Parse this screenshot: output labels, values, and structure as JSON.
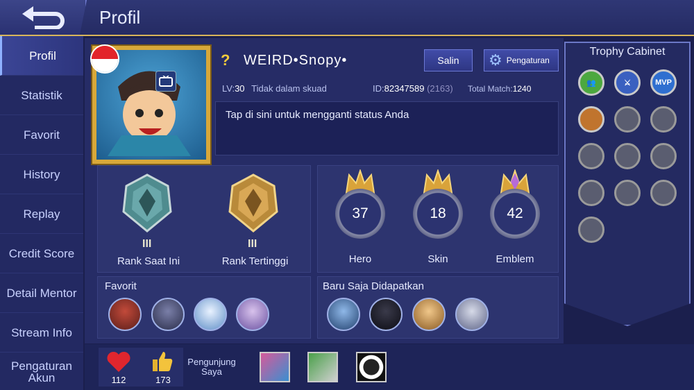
{
  "header": {
    "title": "Profil"
  },
  "sidebar": {
    "items": [
      {
        "label": "Profil"
      },
      {
        "label": "Statistik"
      },
      {
        "label": "Favorit"
      },
      {
        "label": "History"
      },
      {
        "label": "Replay"
      },
      {
        "label": "Credit Score"
      },
      {
        "label": "Detail Mentor"
      },
      {
        "label": "Stream Info"
      },
      {
        "label": "Pengaturan Akun"
      }
    ]
  },
  "profile": {
    "name_prefix": "?",
    "name": "WEIRD•Snopy•",
    "copy_button": "Salin",
    "settings_button": "Pengaturan",
    "level_label": "LV:",
    "level": "30",
    "squad": "Tidak dalam skuad",
    "id_label": "ID:",
    "id": "82347589",
    "server": "(2163)",
    "total_match_label": "Total Match:",
    "total_match": "1240",
    "status_text": "Tap di sini untuk mengganti status Anda"
  },
  "ranks": {
    "current": {
      "label": "Rank Saat Ini",
      "tier": "III"
    },
    "highest": {
      "label": "Rank Tertinggi",
      "tier": "III"
    }
  },
  "stats": [
    {
      "label": "Hero",
      "value": "37"
    },
    {
      "label": "Skin",
      "value": "18"
    },
    {
      "label": "Emblem",
      "value": "42"
    }
  ],
  "favorites": {
    "title": "Favorit"
  },
  "recent": {
    "title": "Baru Saja Didapatkan"
  },
  "trophy_cabinet": {
    "title": "Trophy Cabinet",
    "mvp_text": "MVP"
  },
  "social": {
    "likes": "112",
    "thumbs": "173",
    "visitors_label": "Pengunjung Saya"
  },
  "colors": {
    "accent_gold": "#d8a83a",
    "panel": "#2d346f",
    "background": "#1b1f4d"
  }
}
